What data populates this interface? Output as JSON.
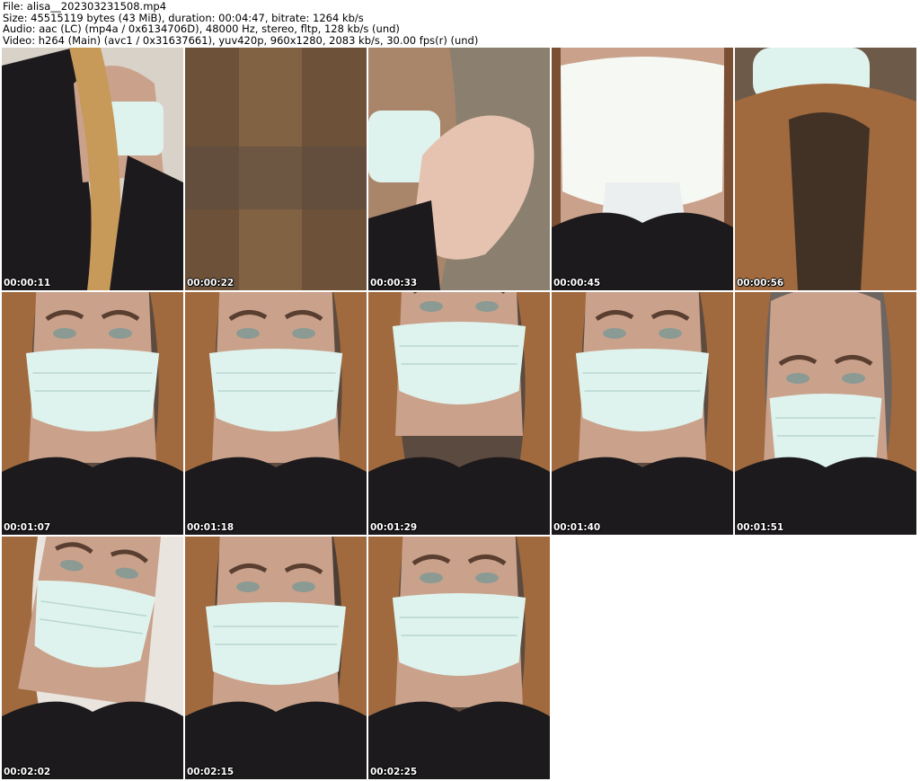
{
  "header": {
    "file_line": "File: alisa__202303231508.mp4",
    "size_line": "Size: 45515119 bytes (43 MiB), duration: 00:04:47, bitrate: 1264 kb/s",
    "audio_line": "Audio: aac (LC) (mp4a / 0x6134706D), 48000 Hz, stereo, fltp, 128 kb/s (und)",
    "video_line": "Video: h264 (Main) (avc1 / 0x31637661), yuv420p, 960x1280, 2083 kb/s, 30.00 fps(r) (und)"
  },
  "thumbnails": [
    {
      "timestamp": "00:00:11",
      "scene": "hair-side"
    },
    {
      "timestamp": "00:00:22",
      "scene": "blur"
    },
    {
      "timestamp": "00:00:33",
      "scene": "hand"
    },
    {
      "timestamp": "00:00:45",
      "scene": "mask-close"
    },
    {
      "timestamp": "00:00:56",
      "scene": "hair-top"
    },
    {
      "timestamp": "00:01:07",
      "scene": "face"
    },
    {
      "timestamp": "00:01:18",
      "scene": "face"
    },
    {
      "timestamp": "00:01:29",
      "scene": "face-up"
    },
    {
      "timestamp": "00:01:40",
      "scene": "face"
    },
    {
      "timestamp": "00:01:51",
      "scene": "face-low"
    },
    {
      "timestamp": "00:02:02",
      "scene": "face-tilt"
    },
    {
      "timestamp": "00:02:15",
      "scene": "face-close"
    },
    {
      "timestamp": "00:02:25",
      "scene": "face"
    }
  ],
  "colors": {
    "background": "#ffffff",
    "header_text": "#000000",
    "timestamp_text": "#ffffff",
    "mask": "#dff3ee",
    "hair": "#a06a3e",
    "fur": "#1c1a1c",
    "skin": "#caa28c"
  }
}
